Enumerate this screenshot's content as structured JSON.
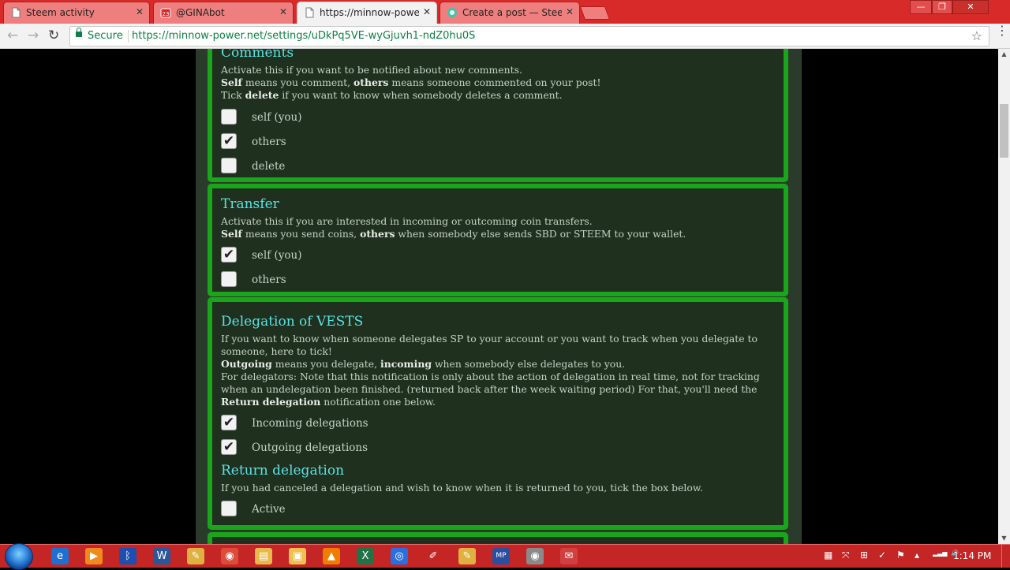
{
  "browser": {
    "tabs": [
      {
        "title": "Steem activity",
        "favicon": "document-icon",
        "active": false
      },
      {
        "title": "@GINAbot",
        "favicon": "calendar-icon",
        "active": false
      },
      {
        "title": "https://minnow-power.n",
        "favicon": "document-icon",
        "active": true
      },
      {
        "title": "Create a post — Steemit",
        "favicon": "steemit-icon",
        "active": false
      }
    ],
    "close_glyph": "✕",
    "window_controls": [
      "—",
      "❐",
      "✕"
    ],
    "secure_label": "Secure",
    "url": "https://minnow-power.net/settings/uDkPq5VE-wyGjuvh1-ndZ0hu0S"
  },
  "sections": {
    "comments": {
      "title": "Comments",
      "line1": "Activate this if you want to be notified about new comments.",
      "line2": {
        "b1": "Self",
        "t1": " means you comment, ",
        "b2": "others",
        "t2": " means someone commented on your post!"
      },
      "line3": {
        "t1": "Tick ",
        "b1": "delete",
        "t2": " if you want to know when somebody deletes a comment."
      },
      "options": [
        {
          "label": "self (you)",
          "checked": false
        },
        {
          "label": "others",
          "checked": true
        },
        {
          "label": "delete",
          "checked": false
        }
      ]
    },
    "transfer": {
      "title": "Transfer",
      "line1": "Activate this if you are interested in incoming or outcoming coin transfers.",
      "line2": {
        "b1": "Self",
        "t1": " means you send coins, ",
        "b2": "others",
        "t2": " when somebody else sends SBD or STEEM to your wallet."
      },
      "options": [
        {
          "label": "self (you)",
          "checked": true
        },
        {
          "label": "others",
          "checked": false
        }
      ]
    },
    "delegation": {
      "title": "Delegation of VESTS",
      "line1": "If you want to know when someone delegates SP to your account or you want to track when you delegate to someone, here to tick!",
      "line2": {
        "b1": "Outgoing",
        "t1": " means you delegate, ",
        "b2": "incoming",
        "t2": " when somebody else delegates to you."
      },
      "line3": {
        "t1": "For delegators: Note that this notification is only about the action of delegation in real time, not for tracking when an undelegation been finished. (returned back after the week waiting period) For that, you'll need the ",
        "b1": "Return delegation",
        "t2": " notification one below."
      },
      "options": [
        {
          "label": "Incoming delegations",
          "checked": true
        },
        {
          "label": "Outgoing delegations",
          "checked": true
        }
      ],
      "return": {
        "title": "Return delegation",
        "line1": "If you had canceled a delegation and wish to know when it is returned to you, tick the box below.",
        "options": [
          {
            "label": "Active",
            "checked": false
          }
        ]
      }
    }
  },
  "check_glyph": "✔",
  "taskbar": {
    "apps": [
      {
        "icon": "internet-explorer-icon",
        "glyph": "e",
        "color": "#1e6fd0"
      },
      {
        "icon": "media-player-icon",
        "glyph": "▶",
        "color": "#f08a1c"
      },
      {
        "icon": "bluetooth-icon",
        "glyph": "ᛒ",
        "color": "#1c4fb0"
      },
      {
        "icon": "word-icon",
        "glyph": "W",
        "color": "#2b579a"
      },
      {
        "icon": "paint-icon",
        "glyph": "✎",
        "color": "#e0b040"
      },
      {
        "icon": "chrome-icon",
        "glyph": "◉",
        "color": "#dd4b39"
      },
      {
        "icon": "file-explorer-icon",
        "glyph": "▤",
        "color": "#e8b84a"
      },
      {
        "icon": "folder-icon",
        "glyph": "▣",
        "color": "#f0c050"
      },
      {
        "icon": "vlc-icon",
        "glyph": "▲",
        "color": "#f07d00"
      },
      {
        "icon": "excel-icon",
        "glyph": "X",
        "color": "#217346"
      },
      {
        "icon": "firefox-icon",
        "glyph": "◎",
        "color": "#2a6fe0"
      },
      {
        "icon": "pen-icon",
        "glyph": "✐",
        "color": "#c42525"
      },
      {
        "icon": "paint-brush-icon",
        "glyph": "✎",
        "color": "#e0b040"
      },
      {
        "icon": "mp-icon",
        "glyph": "MP",
        "color": "#2b4fa0"
      },
      {
        "icon": "chrome-window-icon",
        "glyph": "◉",
        "color": "#8a8a8a"
      },
      {
        "icon": "image-viewer-icon",
        "glyph": "✉",
        "color": "#d04040"
      }
    ],
    "tray": [
      "▦",
      "⤧",
      "⊞",
      "✓",
      "⚑",
      "▴",
      "▂▃▅",
      "🔊"
    ],
    "clock": "1:14 PM"
  }
}
